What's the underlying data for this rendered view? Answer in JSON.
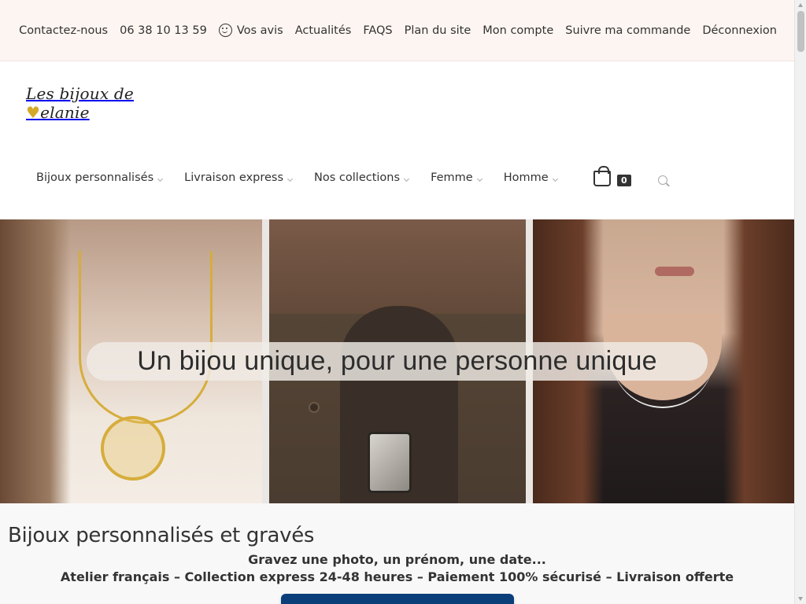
{
  "topbar": {
    "items": [
      {
        "label": "Contactez-nous"
      },
      {
        "label": "06 38 10 13 59"
      },
      {
        "label": "Vos avis",
        "icon": "smile-icon"
      },
      {
        "label": "Actualités"
      },
      {
        "label": "FAQS"
      },
      {
        "label": "Plan du site"
      },
      {
        "label": "Mon compte"
      },
      {
        "label": "Suivre ma commande"
      },
      {
        "label": "Déconnexion"
      }
    ]
  },
  "logo": {
    "text_before": "Les bijoux de ",
    "heart": "♥",
    "text_after": "elanie"
  },
  "nav": {
    "items": [
      {
        "label": "Bijoux personnalisés"
      },
      {
        "label": "Livraison express"
      },
      {
        "label": "Nos collections"
      },
      {
        "label": "Femme"
      },
      {
        "label": "Homme"
      }
    ],
    "cart_count": "0"
  },
  "hero": {
    "banner_text": "Un bijou unique, pour une personne unique"
  },
  "intro": {
    "title": "Bijoux personnalisés et gravés",
    "line1": "Gravez une photo, un prénom, une date...",
    "line2": "Atelier français – Collection express 24-48 heures – Paiement 100% sécurisé – Livraison offerte"
  },
  "colors": {
    "topbar_bg": "#fdf5f1",
    "accent_gold": "#d4a92a",
    "cta_blue": "#0b3f7a"
  }
}
